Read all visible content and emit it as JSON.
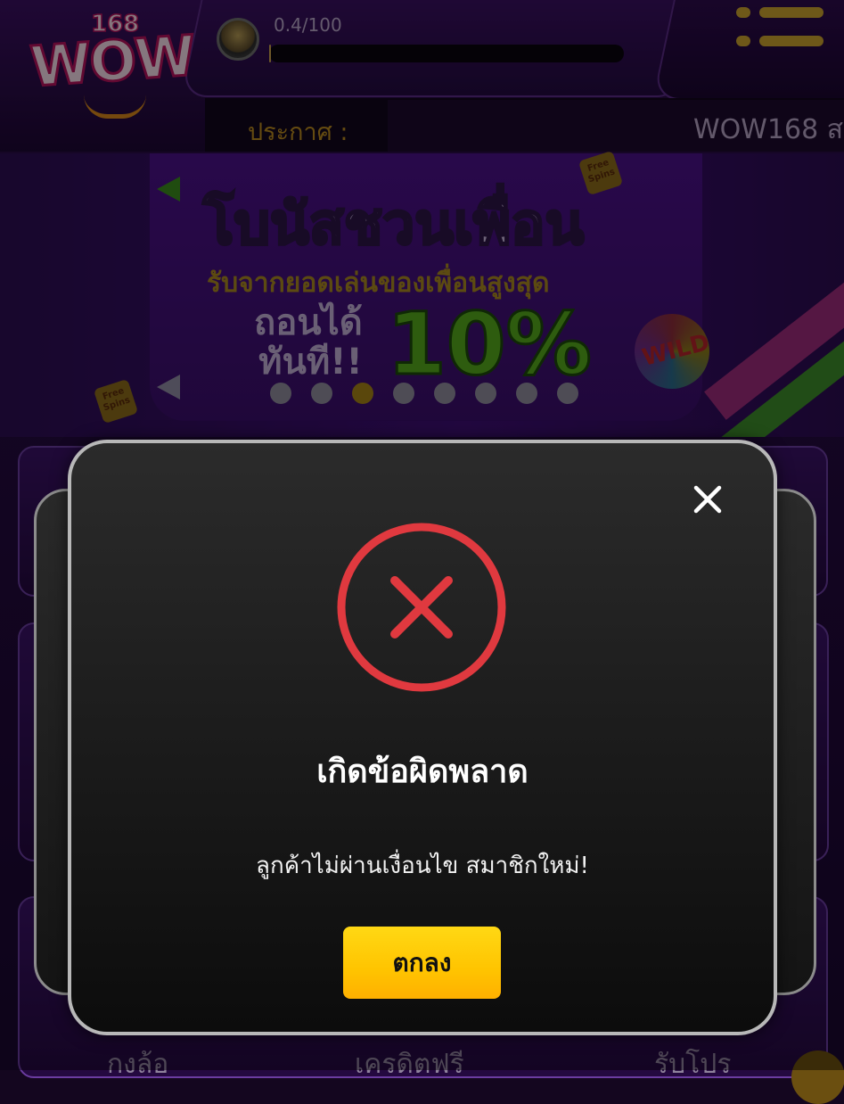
{
  "header": {
    "logo_text": "WOW",
    "logo_number": "168",
    "level_progress_text": "0.4/100",
    "level_progress_fraction": 0.004,
    "announcement_label": "ประกาศ :",
    "announcement_text": "WOW168 ส"
  },
  "banner": {
    "title": "โบนัสชวนเพื่อน",
    "subtitle": "รับจากยอดเล่นของเพื่อนสูงสุด",
    "left_line1": "ถอนได้",
    "left_line2": "ทันที!!",
    "percent": "10%",
    "sticker": "Free Spins",
    "wild": "WILD",
    "slide_count": 8,
    "active_slide": 2
  },
  "bottom_nav": {
    "items": [
      "กงล้อ",
      "เครดิตฟรี",
      "รับโปร"
    ]
  },
  "modal": {
    "title": "เกิดข้อผิดพลาด",
    "message": "ลูกค้าไม่ผ่านเงื่อนไข สมาชิกใหม่!",
    "ok_label": "ตกลง",
    "icon": "error-x-circle-icon",
    "close_icon": "close-icon"
  },
  "colors": {
    "accent_gold": "#ffc400",
    "error_red": "#e0393f",
    "modal_bg": "#1a1a1a",
    "purple_bg": "#2a0c48"
  }
}
